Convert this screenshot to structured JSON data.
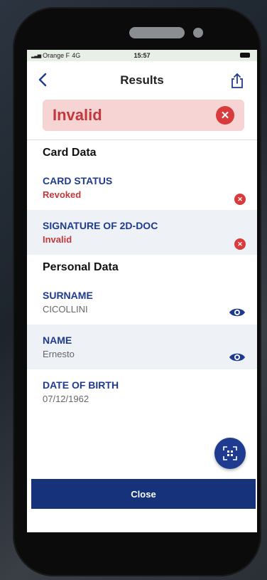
{
  "statusbar": {
    "carrier": "Orange F",
    "network": "4G",
    "time": "15:57"
  },
  "header": {
    "title": "Results"
  },
  "banner": {
    "status": "Invalid"
  },
  "card_data": {
    "title": "Card Data",
    "card_status": {
      "label": "CARD STATUS",
      "value": "Revoked"
    },
    "signature": {
      "label": "SIGNATURE OF 2D-DOC",
      "value": "Invalid"
    }
  },
  "personal_data": {
    "title": "Personal Data",
    "surname": {
      "label": "SURNAME",
      "value": "CICOLLINI"
    },
    "name": {
      "label": "NAME",
      "value": "Ernesto"
    },
    "dob": {
      "label": "DATE OF BIRTH",
      "value": "07/12/1962"
    }
  },
  "footer": {
    "close_label": "Close"
  },
  "colors": {
    "accent": "#1f3b8f",
    "error": "#d93b3d",
    "error_bg": "#f6d4d4",
    "button": "#15327a"
  }
}
